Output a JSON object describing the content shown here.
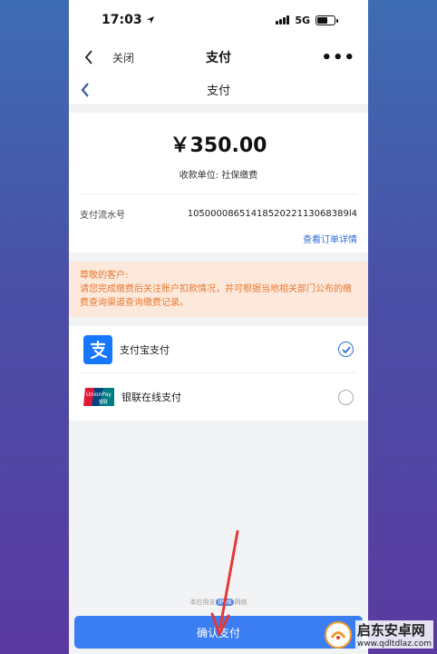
{
  "status_bar": {
    "time": "17:03",
    "network": "5G"
  },
  "nav": {
    "close_label": "关闭",
    "title": "支付"
  },
  "sub_nav": {
    "title": "支付"
  },
  "payment": {
    "amount": "￥350.00",
    "payee": "收款单位: 社保缴费",
    "serial_label": "支付流水号",
    "serial_value": "1050000865141852022113068389l4",
    "order_link": "查看订单详情"
  },
  "notice": {
    "line1": "尊敬的客户:",
    "line2": "请您完成缴费后关注账户扣款情况，并可根据当地相关部门公布的缴费查询渠道查询缴费记录。"
  },
  "methods": [
    {
      "label": "支付宝支付",
      "icon": "alipay-icon",
      "selected": true
    },
    {
      "label": "银联在线支付",
      "icon": "unionpay-icon",
      "selected": false
    }
  ],
  "footer": {
    "prefix": "本应用支",
    "badge": "IPv6",
    "suffix": "网络"
  },
  "confirm": {
    "label": "确认支付"
  },
  "watermark": {
    "title": "启东安卓网",
    "url": "www.qdltdlaz.com"
  },
  "colors": {
    "accent": "#3b7ef3",
    "notice_bg": "#fde9dc",
    "notice_text": "#e9792f",
    "link": "#2f6fd6",
    "arrow": "#e53935"
  }
}
